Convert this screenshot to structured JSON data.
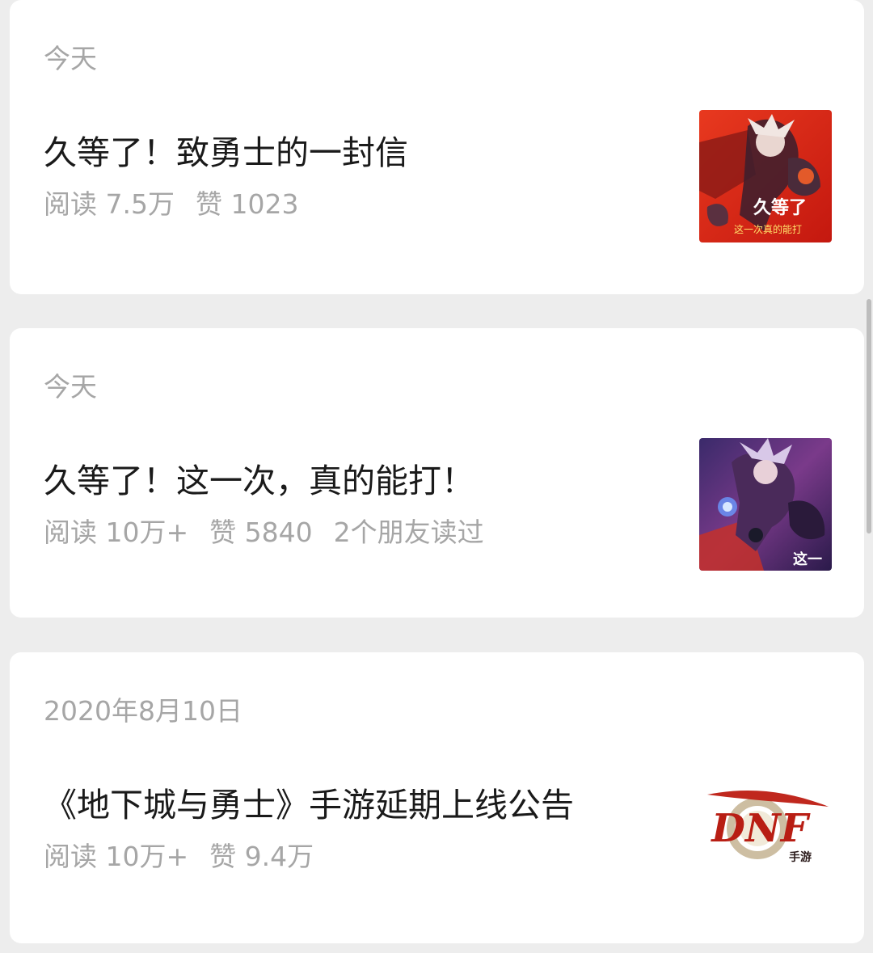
{
  "articles": [
    {
      "date": "今天",
      "title": "久等了！致勇士的一封信",
      "reads": "阅读 7.5万",
      "likes": "赞 1023",
      "friends": "",
      "thumb_text_1": "久等了",
      "thumb_text_2": "这一次真的能打",
      "thumb_icon": "game-poster-red"
    },
    {
      "date": "今天",
      "title": "久等了！这一次，真的能打！",
      "reads": "阅读 10万+",
      "likes": "赞 5840",
      "friends": "2个朋友读过",
      "thumb_text_1": "这一",
      "thumb_icon": "game-poster-purple"
    },
    {
      "date": "2020年8月10日",
      "title": "《地下城与勇士》手游延期上线公告",
      "reads": "阅读 10万+",
      "likes": "赞 9.4万",
      "friends": "",
      "thumb_text_1": "DNF",
      "thumb_text_2": "手游",
      "thumb_icon": "dnf-logo"
    }
  ],
  "colors": {
    "background": "#ededed",
    "card": "#ffffff",
    "meta": "#a6a6a6",
    "title": "#1a1a1a"
  }
}
